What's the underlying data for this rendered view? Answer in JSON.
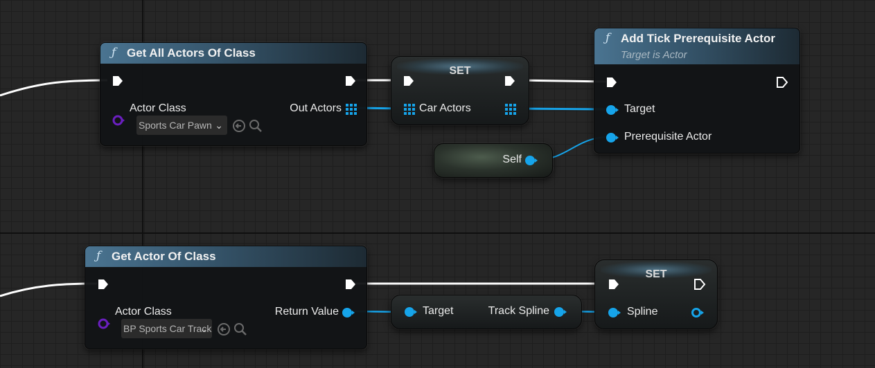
{
  "colors": {
    "exec_wire": "#ffffff",
    "object_pin": "#16a4ea",
    "class_pin": "#6a1fbf",
    "header_blue": "#4a7491"
  },
  "icons": {
    "function": "function-icon",
    "exec": "exec-pin-icon",
    "array": "array-pin-icon",
    "object": "object-pin-icon",
    "class": "class-pin-icon",
    "use_selected": "use-selected-icon",
    "browse": "search-icon",
    "dropdown": "chevron-down-icon"
  },
  "nodes": {
    "get_all_actors": {
      "title": "Get All Actors Of Class",
      "fn_glyph": "ƒ",
      "actor_class_label": "Actor Class",
      "actor_class_value": "Sports Car Pawn",
      "out_label": "Out Actors"
    },
    "set_car_actors": {
      "title": "SET",
      "var_label": "Car Actors"
    },
    "add_tick": {
      "title": "Add Tick Prerequisite Actor",
      "subtitle": "Target is Actor",
      "fn_glyph": "ƒ",
      "target_label": "Target",
      "prereq_label": "Prerequisite Actor"
    },
    "self": {
      "label": "Self"
    },
    "get_actor": {
      "title": "Get Actor Of Class",
      "fn_glyph": "ƒ",
      "actor_class_label": "Actor Class",
      "actor_class_value": "BP Sports Car Track",
      "return_label": "Return Value"
    },
    "track_spline_getter": {
      "target_label": "Target",
      "out_label": "Track Spline"
    },
    "set_spline": {
      "title": "SET",
      "var_label": "Spline"
    }
  }
}
